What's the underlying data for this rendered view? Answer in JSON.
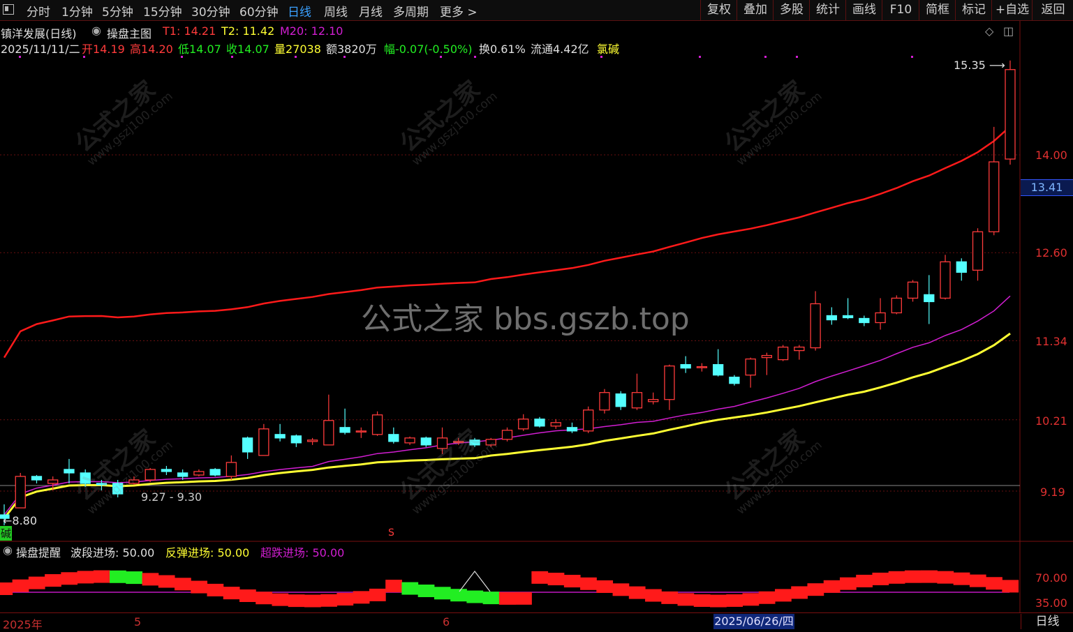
{
  "toolbar": {
    "periods": [
      "分时",
      "1分钟",
      "5分钟",
      "15分钟",
      "30分钟",
      "60分钟",
      "日线",
      "周线",
      "月线",
      "多周期",
      "更多"
    ],
    "active_period": "日线",
    "right_buttons": [
      "复权",
      "叠加",
      "多股",
      "统计",
      "画线",
      "F10",
      "简框",
      "标记",
      "+自选",
      "返回"
    ]
  },
  "header": {
    "stock_name": "镇洋发展(日线)",
    "indicator": "操盘主图",
    "t1_label": "T1:",
    "t1_value": "14.21",
    "t2_label": "T2:",
    "t2_value": "11.42",
    "m20_label": "M20:",
    "m20_value": "12.10"
  },
  "quote": {
    "date": "2025/11/11/二",
    "open_label": "开",
    "open": "14.19",
    "high_label": "高",
    "high": "14.20",
    "low_label": "低",
    "low": "14.07",
    "close_label": "收",
    "close": "14.07",
    "vol_label": "量",
    "volume": "27038",
    "amount": "额3820万",
    "change": "幅-0.07(-0.50%)",
    "turnover": "换0.61%",
    "float_cap": "流通4.42亿",
    "concept": "氯碱"
  },
  "price_axis": [
    "14.00",
    "12.60",
    "11.34",
    "10.21",
    "9.19"
  ],
  "current_price": "13.41",
  "annotations": {
    "high_mark": "15.35",
    "low_mark": "←8.80",
    "mid_mark": "9.27 - 9.30",
    "left_tag": "碱",
    "sig": "S"
  },
  "sub_panel": {
    "title": "操盘提醒",
    "label1": "波段进场:",
    "value1": "50.00",
    "label2": "反弹进场:",
    "value2": "50.00",
    "label3": "超跌进场:",
    "value3": "50.00",
    "axis": [
      "70.00",
      "35.00"
    ]
  },
  "time_axis": {
    "labels": [
      "2025年",
      "5",
      "6"
    ],
    "cursor_date": "2025/06/26/四",
    "period": "日线"
  },
  "watermark": {
    "center": "公式之家 bbs.gszb.top",
    "diag_cn": "公式之家",
    "diag_url": "www.gszj100.com"
  },
  "colors": {
    "up": "#ff3b3b",
    "down": "#54ffff",
    "ma_red": "#ff1a1a",
    "ma_purple": "#d21ed2",
    "ma_yellow": "#ffff33",
    "green_bar": "#22ee22"
  },
  "chart_data": {
    "type": "candlestick",
    "ylim": [
      8.5,
      15.6
    ],
    "candles": [
      {
        "o": 8.85,
        "c": 8.8,
        "h": 9.0,
        "l": 8.7
      },
      {
        "o": 8.95,
        "c": 9.4,
        "h": 9.45,
        "l": 8.95
      },
      {
        "o": 9.4,
        "c": 9.35,
        "h": 9.42,
        "l": 9.3
      },
      {
        "o": 9.3,
        "c": 9.35,
        "h": 9.4,
        "l": 9.2
      },
      {
        "o": 9.5,
        "c": 9.45,
        "h": 9.65,
        "l": 9.3
      },
      {
        "o": 9.45,
        "c": 9.3,
        "h": 9.5,
        "l": 9.25
      },
      {
        "o": 9.3,
        "c": 9.28,
        "h": 9.35,
        "l": 9.2
      },
      {
        "o": 9.3,
        "c": 9.15,
        "h": 9.35,
        "l": 9.1
      },
      {
        "o": 9.3,
        "c": 9.35,
        "h": 9.4,
        "l": 9.28
      },
      {
        "o": 9.35,
        "c": 9.5,
        "h": 9.52,
        "l": 9.32
      },
      {
        "o": 9.5,
        "c": 9.47,
        "h": 9.55,
        "l": 9.42
      },
      {
        "o": 9.45,
        "c": 9.4,
        "h": 9.5,
        "l": 9.35
      },
      {
        "o": 9.42,
        "c": 9.47,
        "h": 9.5,
        "l": 9.4
      },
      {
        "o": 9.5,
        "c": 9.42,
        "h": 9.52,
        "l": 9.4
      },
      {
        "o": 9.4,
        "c": 9.6,
        "h": 9.7,
        "l": 9.35
      },
      {
        "o": 9.95,
        "c": 9.75,
        "h": 9.97,
        "l": 9.65
      },
      {
        "o": 9.7,
        "c": 10.08,
        "h": 10.15,
        "l": 9.7
      },
      {
        "o": 10.0,
        "c": 9.95,
        "h": 10.15,
        "l": 9.9
      },
      {
        "o": 9.98,
        "c": 9.88,
        "h": 10.0,
        "l": 9.82
      },
      {
        "o": 9.9,
        "c": 9.92,
        "h": 9.95,
        "l": 9.85
      },
      {
        "o": 9.85,
        "c": 10.2,
        "h": 10.57,
        "l": 9.85
      },
      {
        "o": 10.1,
        "c": 10.03,
        "h": 10.37,
        "l": 10.0
      },
      {
        "o": 10.05,
        "c": 10.05,
        "h": 10.1,
        "l": 9.95
      },
      {
        "o": 10.0,
        "c": 10.28,
        "h": 10.33,
        "l": 9.98
      },
      {
        "o": 10.0,
        "c": 9.9,
        "h": 10.1,
        "l": 9.87
      },
      {
        "o": 9.88,
        "c": 9.95,
        "h": 9.97,
        "l": 9.85
      },
      {
        "o": 9.95,
        "c": 9.85,
        "h": 9.97,
        "l": 9.82
      },
      {
        "o": 9.8,
        "c": 9.95,
        "h": 10.1,
        "l": 9.72
      },
      {
        "o": 9.9,
        "c": 9.9,
        "h": 9.95,
        "l": 9.85
      },
      {
        "o": 9.92,
        "c": 9.85,
        "h": 9.95,
        "l": 9.82
      },
      {
        "o": 9.85,
        "c": 9.93,
        "h": 9.95,
        "l": 9.82
      },
      {
        "o": 9.93,
        "c": 10.06,
        "h": 10.1,
        "l": 9.9
      },
      {
        "o": 10.08,
        "c": 10.22,
        "h": 10.29,
        "l": 10.05
      },
      {
        "o": 10.22,
        "c": 10.12,
        "h": 10.25,
        "l": 10.1
      },
      {
        "o": 10.12,
        "c": 10.17,
        "h": 10.22,
        "l": 10.08
      },
      {
        "o": 10.1,
        "c": 10.05,
        "h": 10.17,
        "l": 10.02
      },
      {
        "o": 10.05,
        "c": 10.35,
        "h": 10.4,
        "l": 10.02
      },
      {
        "o": 10.35,
        "c": 10.6,
        "h": 10.65,
        "l": 10.3
      },
      {
        "o": 10.58,
        "c": 10.4,
        "h": 10.62,
        "l": 10.35
      },
      {
        "o": 10.38,
        "c": 10.6,
        "h": 10.87,
        "l": 10.35
      },
      {
        "o": 10.47,
        "c": 10.5,
        "h": 10.6,
        "l": 10.43
      },
      {
        "o": 10.5,
        "c": 10.98,
        "h": 11.0,
        "l": 10.35
      },
      {
        "o": 11.0,
        "c": 10.95,
        "h": 11.12,
        "l": 10.88
      },
      {
        "o": 10.97,
        "c": 10.97,
        "h": 11.02,
        "l": 10.9
      },
      {
        "o": 11.0,
        "c": 10.85,
        "h": 11.22,
        "l": 10.83
      },
      {
        "o": 10.82,
        "c": 10.73,
        "h": 10.85,
        "l": 10.7
      },
      {
        "o": 10.85,
        "c": 11.08,
        "h": 11.1,
        "l": 10.67
      },
      {
        "o": 11.1,
        "c": 11.13,
        "h": 11.17,
        "l": 10.85
      },
      {
        "o": 11.07,
        "c": 11.25,
        "h": 11.28,
        "l": 11.05
      },
      {
        "o": 11.2,
        "c": 11.25,
        "h": 11.28,
        "l": 11.07
      },
      {
        "o": 11.24,
        "c": 11.87,
        "h": 12.05,
        "l": 11.2
      },
      {
        "o": 11.7,
        "c": 11.64,
        "h": 11.82,
        "l": 11.57
      },
      {
        "o": 11.7,
        "c": 11.67,
        "h": 11.95,
        "l": 11.65
      },
      {
        "o": 11.66,
        "c": 11.6,
        "h": 11.7,
        "l": 11.55
      },
      {
        "o": 11.6,
        "c": 11.74,
        "h": 11.95,
        "l": 11.5
      },
      {
        "o": 11.74,
        "c": 11.95,
        "h": 11.99,
        "l": 11.72
      },
      {
        "o": 11.95,
        "c": 12.18,
        "h": 12.21,
        "l": 11.9
      },
      {
        "o": 12.0,
        "c": 11.9,
        "h": 12.28,
        "l": 11.58
      },
      {
        "o": 11.95,
        "c": 12.47,
        "h": 12.57,
        "l": 11.93
      },
      {
        "o": 12.47,
        "c": 12.32,
        "h": 12.52,
        "l": 12.2
      },
      {
        "o": 12.35,
        "c": 12.9,
        "h": 12.95,
        "l": 12.2
      },
      {
        "o": 12.9,
        "c": 13.9,
        "h": 14.4,
        "l": 12.85
      },
      {
        "o": 13.94,
        "c": 15.22,
        "h": 15.35,
        "l": 13.86
      }
    ]
  }
}
